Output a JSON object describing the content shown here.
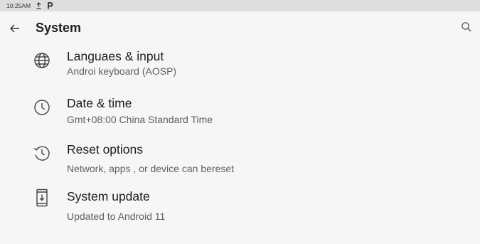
{
  "status_bar": {
    "time": "10:25AM"
  },
  "app_bar": {
    "title": "System"
  },
  "items": [
    {
      "icon": "globe-icon",
      "title": "Languaes & input",
      "subtitle": "Androi keyboard (AOSP)"
    },
    {
      "icon": "clock-icon",
      "title": "Date & time",
      "subtitle": "Gmt+08:00 China Standard Time"
    },
    {
      "icon": "history-icon",
      "title": "Reset options",
      "subtitle": "Network, apps , or device can bereset"
    },
    {
      "icon": "system-update-icon",
      "title": "System update",
      "subtitle": "Updated to Android 11"
    }
  ],
  "colors": {
    "background": "#f6f6f6",
    "status_bar": "#dedede",
    "text_primary": "#1c1c1c",
    "text_secondary": "#5f5f5f",
    "icon": "#444444"
  }
}
